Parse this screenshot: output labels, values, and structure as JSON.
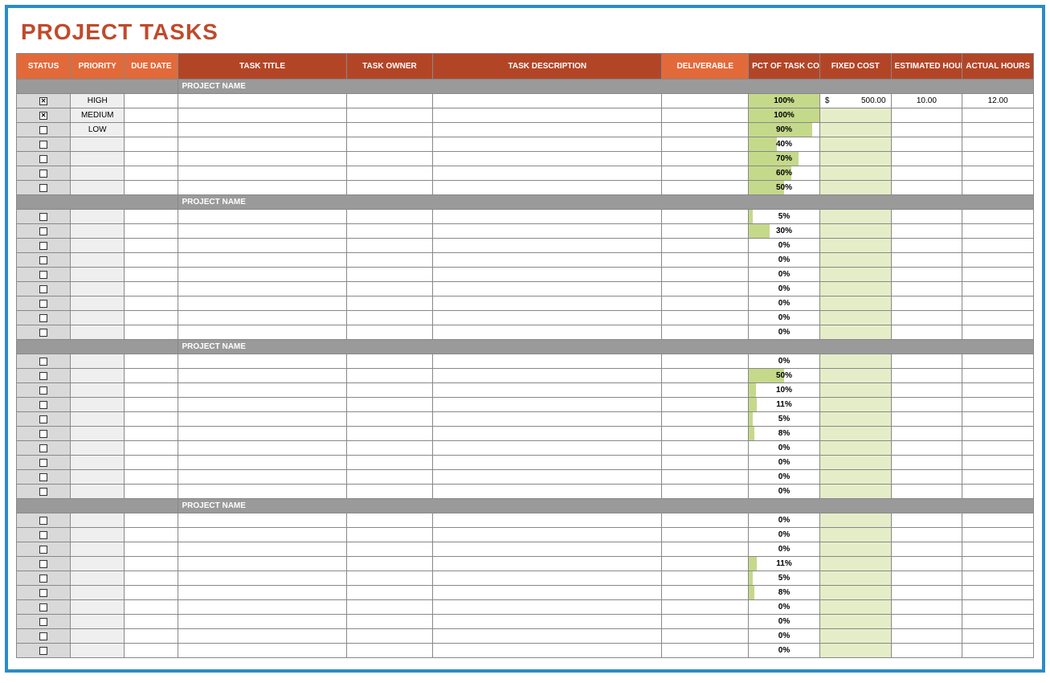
{
  "title": "PROJECT TASKS",
  "headers": {
    "status": "STATUS",
    "priority": "PRIORITY",
    "due_date": "DUE DATE",
    "task_title": "TASK TITLE",
    "task_owner": "TASK OWNER",
    "task_description": "TASK DESCRIPTION",
    "deliverable": "DELIVERABLE",
    "pct_complete": "PCT OF TASK COMPLETE",
    "fixed_cost": "FIXED COST",
    "estimated_hours": "ESTIMATED HOURS",
    "actual_hours": "ACTUAL HOURS"
  },
  "section_label": "PROJECT NAME",
  "sections": [
    {
      "rows": [
        {
          "checked": true,
          "priority": "HIGH",
          "pct": 100,
          "fixed_cost_currency": "$",
          "fixed_cost_value": "500.00",
          "est_hours": "10.00",
          "act_hours": "12.00"
        },
        {
          "checked": true,
          "priority": "MEDIUM",
          "pct": 100
        },
        {
          "checked": false,
          "priority": "LOW",
          "pct": 90
        },
        {
          "checked": false,
          "priority": "",
          "pct": 40
        },
        {
          "checked": false,
          "priority": "",
          "pct": 70
        },
        {
          "checked": false,
          "priority": "",
          "pct": 60
        },
        {
          "checked": false,
          "priority": "",
          "pct": 50
        }
      ]
    },
    {
      "rows": [
        {
          "checked": false,
          "priority": "",
          "pct": 5
        },
        {
          "checked": false,
          "priority": "",
          "pct": 30
        },
        {
          "checked": false,
          "priority": "",
          "pct": 0
        },
        {
          "checked": false,
          "priority": "",
          "pct": 0
        },
        {
          "checked": false,
          "priority": "",
          "pct": 0
        },
        {
          "checked": false,
          "priority": "",
          "pct": 0
        },
        {
          "checked": false,
          "priority": "",
          "pct": 0
        },
        {
          "checked": false,
          "priority": "",
          "pct": 0
        },
        {
          "checked": false,
          "priority": "",
          "pct": 0
        }
      ]
    },
    {
      "rows": [
        {
          "checked": false,
          "priority": "",
          "pct": 0
        },
        {
          "checked": false,
          "priority": "",
          "pct": 50
        },
        {
          "checked": false,
          "priority": "",
          "pct": 10
        },
        {
          "checked": false,
          "priority": "",
          "pct": 11
        },
        {
          "checked": false,
          "priority": "",
          "pct": 5
        },
        {
          "checked": false,
          "priority": "",
          "pct": 8
        },
        {
          "checked": false,
          "priority": "",
          "pct": 0
        },
        {
          "checked": false,
          "priority": "",
          "pct": 0
        },
        {
          "checked": false,
          "priority": "",
          "pct": 0
        },
        {
          "checked": false,
          "priority": "",
          "pct": 0
        }
      ]
    },
    {
      "rows": [
        {
          "checked": false,
          "priority": "",
          "pct": 0
        },
        {
          "checked": false,
          "priority": "",
          "pct": 0
        },
        {
          "checked": false,
          "priority": "",
          "pct": 0
        },
        {
          "checked": false,
          "priority": "",
          "pct": 11
        },
        {
          "checked": false,
          "priority": "",
          "pct": 5
        },
        {
          "checked": false,
          "priority": "",
          "pct": 8
        },
        {
          "checked": false,
          "priority": "",
          "pct": 0
        },
        {
          "checked": false,
          "priority": "",
          "pct": 0
        },
        {
          "checked": false,
          "priority": "",
          "pct": 0
        },
        {
          "checked": false,
          "priority": "",
          "pct": 0
        }
      ]
    }
  ]
}
